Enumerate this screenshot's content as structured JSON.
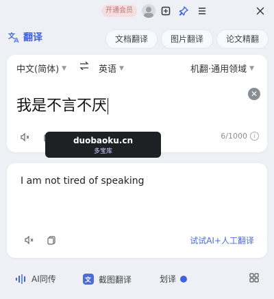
{
  "titlebar": {
    "vip_label": "开通会员",
    "icons": [
      "avatar",
      "screenshot-icon",
      "pin-icon",
      "menu-icon",
      "close-icon"
    ]
  },
  "header": {
    "brand_name": "翻译",
    "features": [
      "文档翻译",
      "图片翻译",
      "论文精翻"
    ]
  },
  "source": {
    "from_lang": "中文(简体)",
    "to_lang": "英语",
    "engine": "机翻·通用领域",
    "text": "我是不言不厌",
    "counter": "6/1000"
  },
  "watermark": {
    "main": "duobaoku.cn",
    "sub": "多宝库"
  },
  "target": {
    "text": "I am not tired of speaking",
    "human_translate": "试试AI+人工翻译"
  },
  "bottom": {
    "ai_interp": "AI同传",
    "screenshot_translate": "截图翻译",
    "word_select": "划译"
  },
  "colors": {
    "accent": "#3f63e0",
    "link": "#4a6bd8",
    "background": "#eef0f6"
  }
}
